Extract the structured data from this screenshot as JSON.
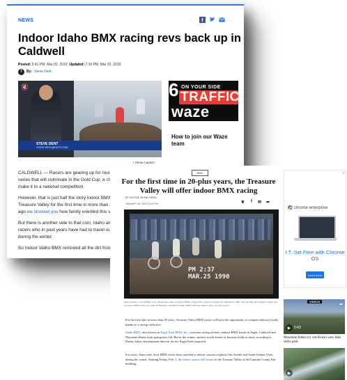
{
  "article1": {
    "section": "NEWS",
    "headline": "Indoor Idaho BMX racing revs back up in Caldwell",
    "posted_label": "Posted:",
    "posted": "5:41 PM, Mar 02, 2019",
    "updated_label": "Updated:",
    "updated": "7:16 PM, Mar 02, 2019",
    "by_label": "By:",
    "author": "Steve Dent",
    "lower_third_name": "STEVE DENT",
    "lower_third_sub": "STEVE.DENT@KIVITV.COM",
    "show_caption": "+ Show Caption",
    "ad": {
      "number": "6",
      "on_your_side": "ON YOUR SIDE",
      "traffic": "TRAFFIC",
      "waze": "waze",
      "caption": "How to join our Waze team"
    },
    "paragraphs": [
      "CALDWELL — Racers are gearing up for round tw",
      "series that will culminate in the Gold Cup, a chanc",
      "make it to a national competition.",
      "However, that is just half the story indoor BMX ra",
      "Treasure Valley for the first time in more than 20",
      "ago we showed you how family oriented this sport",
      "But there is another side to that coin, Idaho also h",
      "racers who in past years have had to travel out of",
      "during the winter.",
      "So Indoor Idaho BMX removed all the dirt from th"
    ],
    "link_text": "we showed you"
  },
  "article2": {
    "section_badge": "BMX",
    "headline": "For the first time in 20-plus years, the Treasure Valley will offer indoor BMX racing",
    "byline": "BY NICOLE BLANCHARD",
    "date": "JANUARY 28, 2019 10:02 PM",
    "icons": [
      "twitter-icon",
      "facebook-icon",
      "email-icon",
      "share-icon"
    ],
    "icon_glyphs": [
      "❦",
      "f",
      "✉",
      "➦"
    ],
    "photo_timestamp_1": "PM 2:37",
    "photo_timestamp_2": "MAR.25 1990",
    "photo_caption": "Andy Andrea, a local BMX racer, shared this video of indoor BMX racing at the Canyon County Fair building in 1990. The last time the Treasure Valley had an indoor BMX track was 1994. In February and March, Idaho BMX will host indoor races. (e-acm-orders)",
    "para1": "For the first time in more than 20 years, Treasure Valley BMX racers will have the opportunity to compete indoors locally thanks to a racing collective.",
    "para2_link1": "Idaho BMX",
    "para2_mid": ", also known as ",
    "para2_link2": "Eagle Park BMX, Inc.",
    "para2_rest": ", oversees racing at three outdoor BMX tracks in Eagle, Caldwell and Mountain Home from spring into fall. But in the winter, outdoor tracks freeze or become fields of mud, according to Danny Adair, development director for the Eagle Park nonprofit.",
    "para3_start": "For years, Adair said, local BMX racers have traveled to indoor courses in places like Seattle and South Jordan, Utah, during the winter. Starting Friday, Feb. 1, ",
    "para3_link": "the indoor option will return",
    "para3_end": " to the Treasure Valley at the Canyon County Fair building."
  },
  "rail": {
    "ad_close": "x",
    "ad_brand": "chrome enterprise",
    "ad_headline": "I.T. Set Free with Chrome OS",
    "ad_button": "Learn more",
    "video_label": "VIDEOS",
    "video_duration": "0:43",
    "video_title": "Mountain bikers try out Boise's new bike skills park"
  }
}
